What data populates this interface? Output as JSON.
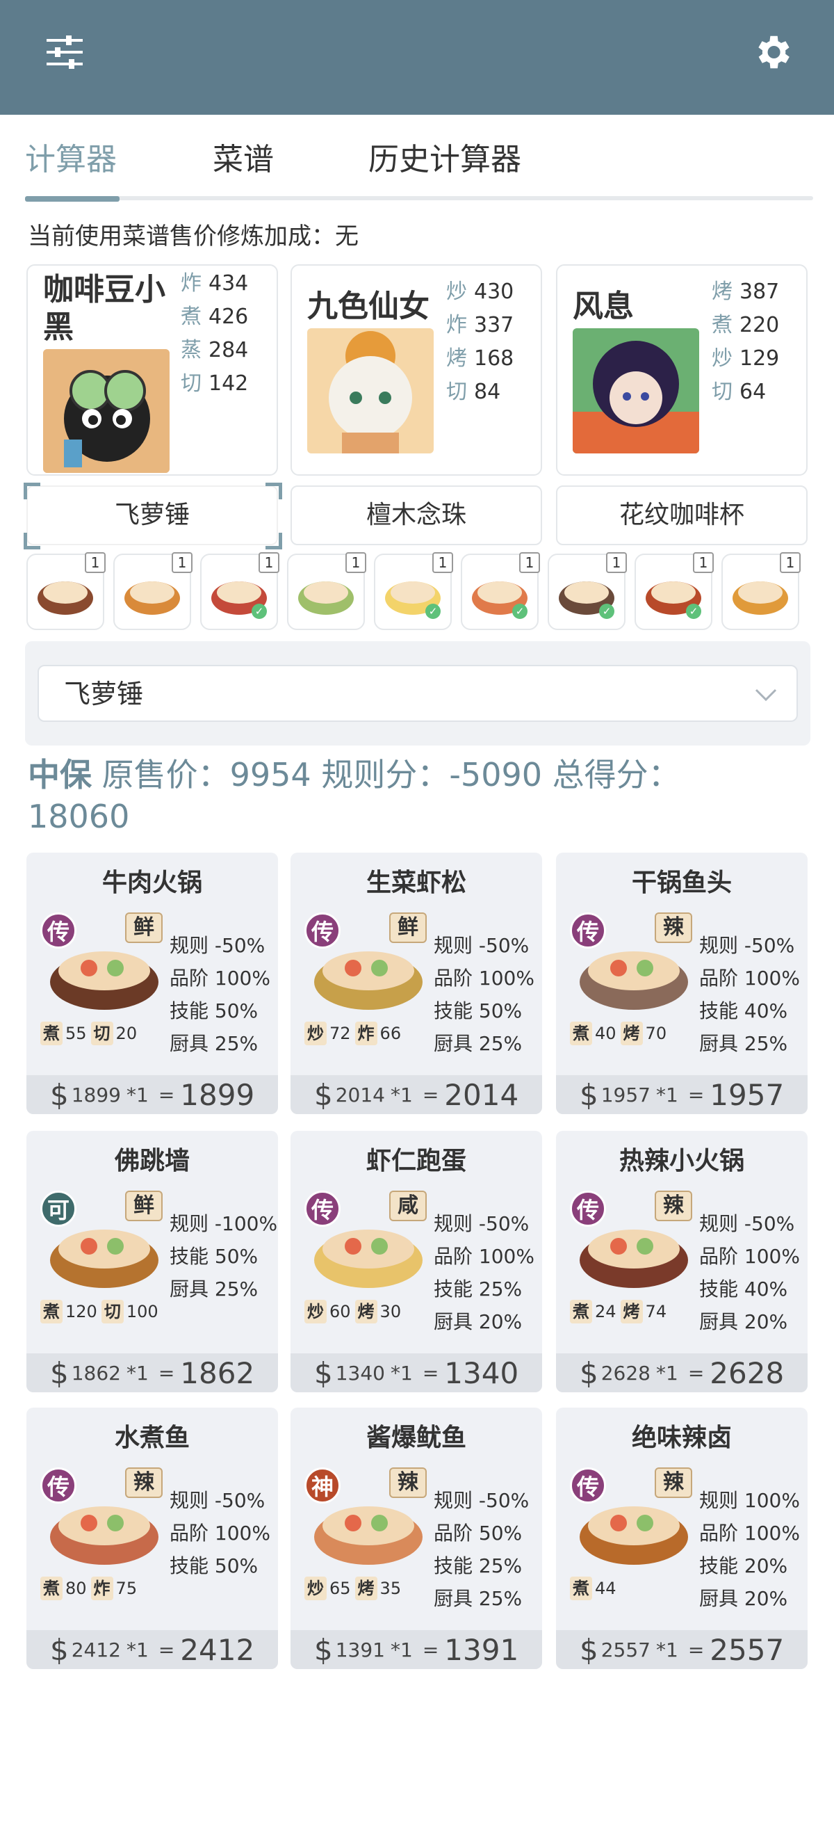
{
  "topbar": {
    "menu_icon": "sliders-icon",
    "settings_icon": "gear-icon"
  },
  "tabs": [
    {
      "label": "计算器",
      "active": true
    },
    {
      "label": "菜谱",
      "active": false
    },
    {
      "label": "历史计算器",
      "active": false
    }
  ],
  "bonus_line": "当前使用菜谱售价修炼加成：无",
  "chefs": [
    {
      "name": "咖啡豆小黑",
      "skills": [
        {
          "label": "炸",
          "value": "434"
        },
        {
          "label": "煮",
          "value": "426"
        },
        {
          "label": "蒸",
          "value": "284"
        },
        {
          "label": "切",
          "value": "142"
        }
      ]
    },
    {
      "name": "九色仙女",
      "skills": [
        {
          "label": "炒",
          "value": "430"
        },
        {
          "label": "炸",
          "value": "337"
        },
        {
          "label": "烤",
          "value": "168"
        },
        {
          "label": "切",
          "value": "84"
        }
      ]
    },
    {
      "name": "风息",
      "skills": [
        {
          "label": "烤",
          "value": "387"
        },
        {
          "label": "煮",
          "value": "220"
        },
        {
          "label": "炒",
          "value": "129"
        },
        {
          "label": "切",
          "value": "64"
        }
      ]
    }
  ],
  "equipment": [
    "飞萝锤",
    "檀木念珠",
    "花纹咖啡杯"
  ],
  "thumbs": [
    {
      "count": "1",
      "checked": false
    },
    {
      "count": "1",
      "checked": false
    },
    {
      "count": "1",
      "checked": true
    },
    {
      "count": "1",
      "checked": false
    },
    {
      "count": "1",
      "checked": true
    },
    {
      "count": "1",
      "checked": true
    },
    {
      "count": "1",
      "checked": true
    },
    {
      "count": "1",
      "checked": true
    },
    {
      "count": "1",
      "checked": false
    }
  ],
  "select": {
    "value": "飞萝锤"
  },
  "summary": {
    "grade": "中保",
    "orig_label": "原售价：",
    "orig_value": "9954",
    "rule_label": "规则分：",
    "rule_value": "-5090",
    "total_label": "总得分：",
    "total_value": "18060"
  },
  "dishes": [
    {
      "name": "牛肉火锅",
      "rarity": "传",
      "flavor": "鲜",
      "mods": [
        "规则 -50%",
        "品阶 100%",
        "技能 50%",
        "厨具 25%"
      ],
      "skills": [
        {
          "label": "煮",
          "value": "55"
        },
        {
          "label": "切",
          "value": "20"
        }
      ],
      "price": "1899",
      "qty": "*1",
      "eq": "=",
      "total": "1899"
    },
    {
      "name": "生菜虾松",
      "rarity": "传",
      "flavor": "鲜",
      "mods": [
        "规则 -50%",
        "品阶 100%",
        "技能 50%",
        "厨具 25%"
      ],
      "skills": [
        {
          "label": "炒",
          "value": "72"
        },
        {
          "label": "炸",
          "value": "66"
        }
      ],
      "price": "2014",
      "qty": "*1",
      "eq": "=",
      "total": "2014"
    },
    {
      "name": "干锅鱼头",
      "rarity": "传",
      "flavor": "辣",
      "mods": [
        "规则 -50%",
        "品阶 100%",
        "技能 40%",
        "厨具 25%"
      ],
      "skills": [
        {
          "label": "煮",
          "value": "40"
        },
        {
          "label": "烤",
          "value": "70"
        }
      ],
      "price": "1957",
      "qty": "*1",
      "eq": "=",
      "total": "1957"
    },
    {
      "name": "佛跳墙",
      "rarity": "可",
      "flavor": "鲜",
      "mods": [
        "规则 -100%",
        "技能 50%",
        "厨具 25%"
      ],
      "skills": [
        {
          "label": "煮",
          "value": "120"
        },
        {
          "label": "切",
          "value": "100"
        }
      ],
      "price": "1862",
      "qty": "*1",
      "eq": "=",
      "total": "1862"
    },
    {
      "name": "虾仁跑蛋",
      "rarity": "传",
      "flavor": "咸",
      "mods": [
        "规则 -50%",
        "品阶 100%",
        "技能 25%",
        "厨具 20%"
      ],
      "skills": [
        {
          "label": "炒",
          "value": "60"
        },
        {
          "label": "烤",
          "value": "30"
        }
      ],
      "price": "1340",
      "qty": "*1",
      "eq": "=",
      "total": "1340"
    },
    {
      "name": "热辣小火锅",
      "rarity": "传",
      "flavor": "辣",
      "mods": [
        "规则 -50%",
        "品阶 100%",
        "技能 40%",
        "厨具 20%"
      ],
      "skills": [
        {
          "label": "煮",
          "value": "24"
        },
        {
          "label": "烤",
          "value": "74"
        }
      ],
      "price": "2628",
      "qty": "*1",
      "eq": "=",
      "total": "2628"
    },
    {
      "name": "水煮鱼",
      "rarity": "传",
      "flavor": "辣",
      "mods": [
        "规则 -50%",
        "品阶 100%",
        "技能 50%"
      ],
      "skills": [
        {
          "label": "煮",
          "value": "80"
        },
        {
          "label": "炸",
          "value": "75"
        }
      ],
      "price": "2412",
      "qty": "*1",
      "eq": "=",
      "total": "2412"
    },
    {
      "name": "酱爆鱿鱼",
      "rarity": "神",
      "flavor": "辣",
      "mods": [
        "规则 -50%",
        "品阶 50%",
        "技能 25%",
        "厨具 25%"
      ],
      "skills": [
        {
          "label": "炒",
          "value": "65"
        },
        {
          "label": "烤",
          "value": "35"
        }
      ],
      "price": "1391",
      "qty": "*1",
      "eq": "=",
      "total": "1391"
    },
    {
      "name": "绝味辣卤",
      "rarity": "传",
      "flavor": "辣",
      "mods": [
        "规则 100%",
        "品阶 100%",
        "技能 20%",
        "厨具 20%"
      ],
      "skills": [
        {
          "label": "煮",
          "value": "44"
        }
      ],
      "price": "2557",
      "qty": "*1",
      "eq": "=",
      "total": "2557"
    }
  ],
  "colors": {
    "topbar": "#5e7c8c",
    "accent": "#7f9eaa",
    "rarity_chuan": "#8a3f7a",
    "rarity_ke": "#3f6b6b",
    "rarity_shen": "#b84a2a"
  }
}
